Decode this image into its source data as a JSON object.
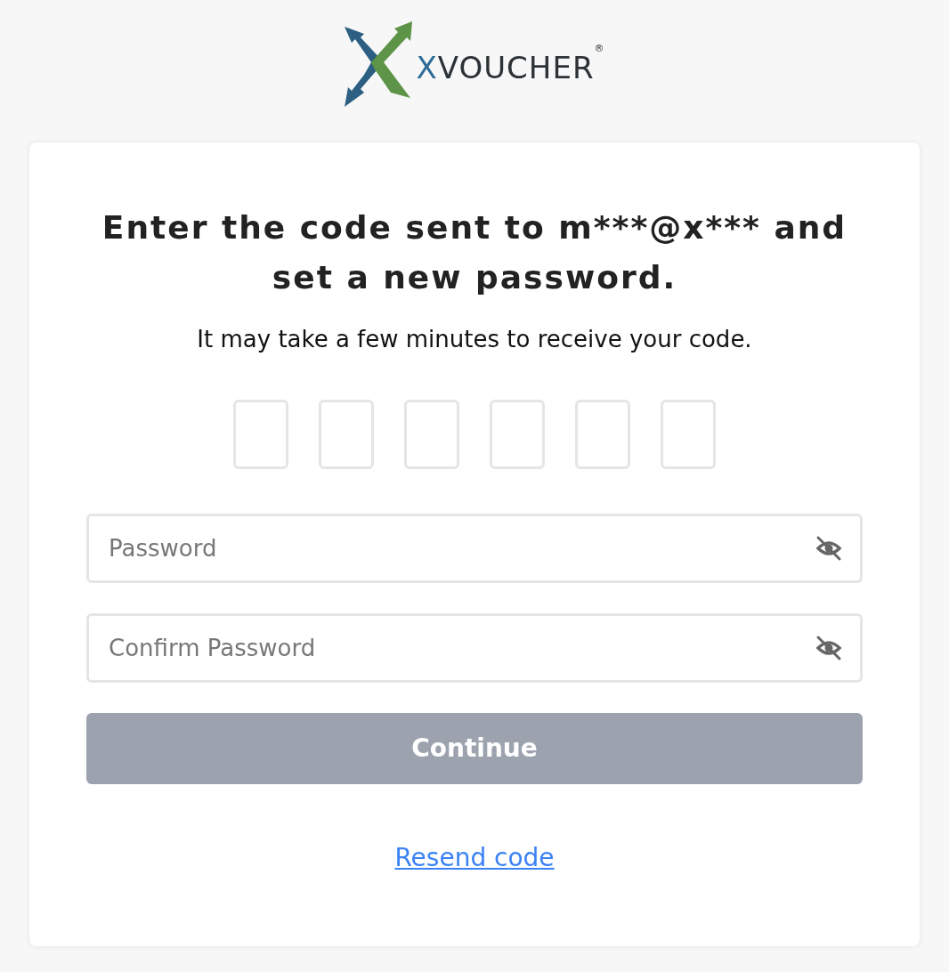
{
  "logo": {
    "accent": "X",
    "rest": "VOUCHER",
    "mark": "®"
  },
  "card": {
    "heading": "Enter the code sent to m***@x*** and set a new password.",
    "subtitle": "It may take a few minutes to receive your code.",
    "code_boxes": [
      {
        "filled": false
      },
      {
        "filled": false
      },
      {
        "filled": false
      },
      {
        "filled": false
      },
      {
        "filled": false
      },
      {
        "filled": false
      }
    ],
    "fields": [
      {
        "placeholder": "Password",
        "masked": true
      },
      {
        "placeholder": "Confirm Password",
        "masked": true
      }
    ],
    "button": {
      "label": "Continue",
      "disabled": true
    },
    "link": "Resend code"
  }
}
